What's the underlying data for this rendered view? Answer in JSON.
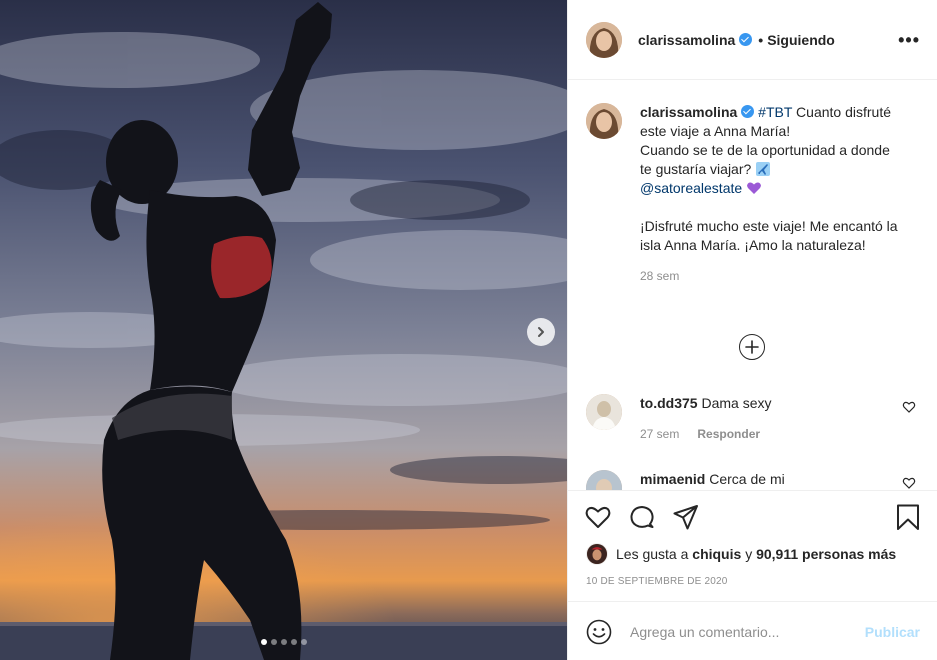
{
  "post": {
    "username": "clarissamolina",
    "verified": true,
    "separator": "•",
    "follow_status": "Siguiendo",
    "more_label": "•••"
  },
  "media": {
    "slide_count": 5,
    "active_slide": 1,
    "next_icon": "chevron-right-icon"
  },
  "caption": {
    "username": "clarissamolina",
    "hashtag": "#TBT",
    "text_1": " Cuanto disfruté este viaje a Anna María!",
    "text_2": "Cuando se te de la oportunidad a donde te gustaría viajar?",
    "mention": "@satorealestate",
    "text_3": "¡Disfruté mucho este viaje! Me encantó la isla Anna María. ¡Amo la naturaleza!",
    "time": "28 sem"
  },
  "load_more_icon": "plus-circle-icon",
  "comments": [
    {
      "username": "to.dd375",
      "text": "Dama sexy",
      "time": "27 sem",
      "reply_label": "Responder"
    },
    {
      "username": "mimaenid",
      "text": "Cerca de mi"
    }
  ],
  "actions": {
    "like_icon": "heart-icon",
    "comment_icon": "comment-icon",
    "share_icon": "share-icon",
    "save_icon": "bookmark-icon"
  },
  "likes": {
    "prefix": "Les gusta a ",
    "user": "chiquis",
    "conj": " y ",
    "count": "90,911 personas más"
  },
  "date": "10 DE SEPTIEMBRE DE 2020",
  "add_comment": {
    "placeholder": "Agrega un comentario...",
    "publish_label": "Publicar",
    "emoji_icon": "smiley-icon"
  },
  "colors": {
    "link": "#00376b",
    "verified": "#3897f0",
    "publish_disabled": "#b2dffc",
    "muted": "#8e8e8e"
  }
}
